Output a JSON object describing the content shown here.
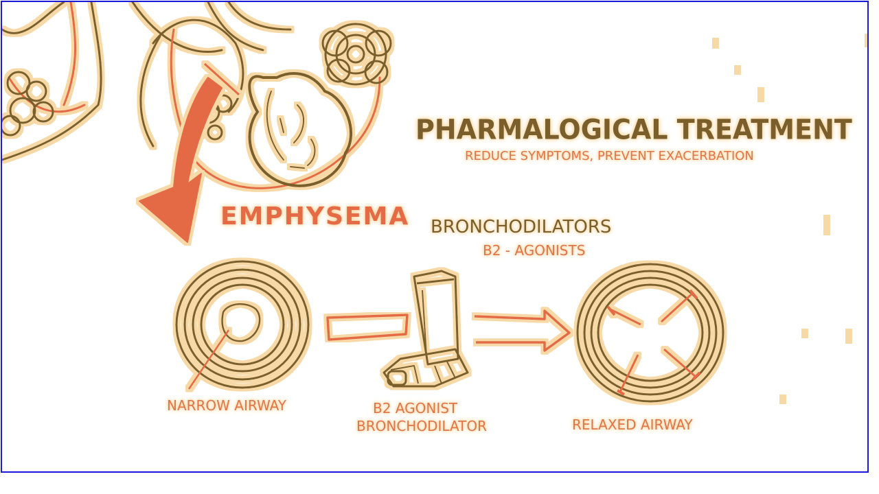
{
  "diagram": {
    "title": "PHARMALOGICAL TREATMENT",
    "subtitle": "REDUCE SYMPTOMS, PREVENT EXACERBATION",
    "emphysema_label": "EMPHYSEMA",
    "bronchodilators_label": "BRONCHODILATORS",
    "b2_agonists_label": "B2 - AGONISTS",
    "narrow_airway_label": "NARROW AIRWAY",
    "agonist_label_line1": "B2 AGONIST",
    "agonist_label_line2": "BRONCHODILATOR",
    "relaxed_airway_label": "RELAXED AIRWAY"
  },
  "colors": {
    "outline": "#7a5f2c",
    "accent_red": "#e46b45",
    "highlight": "#f6d9a6",
    "frame_border": "#1a1adb"
  },
  "icons": [
    "lung-drawing-icon",
    "alveoli-cluster-icon",
    "down-arrow-icon",
    "airway-ring-icon",
    "inhaler-icon",
    "right-arrow-icon"
  ]
}
